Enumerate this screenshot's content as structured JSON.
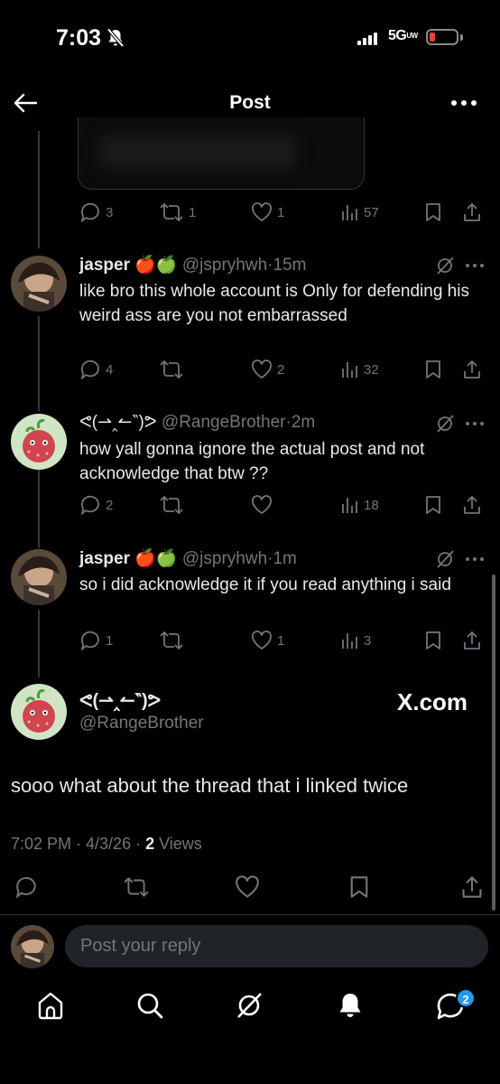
{
  "status_bar": {
    "time": "7:03",
    "network": "5G",
    "network_sub": "UW"
  },
  "header": {
    "title": "Post"
  },
  "parent_post": {
    "stats": {
      "replies": "3",
      "reposts": "1",
      "likes": "1",
      "views": "57"
    }
  },
  "replies": [
    {
      "name": "jasper",
      "emojis": "🍎🍏",
      "handle": "@jspryhwh",
      "time": "15m",
      "text": "like bro this whole account is Only for defending his weird ass are you not embarrassed",
      "stats": {
        "replies": "4",
        "reposts": "",
        "likes": "2",
        "views": "32"
      }
    },
    {
      "name": "ᕙ(⇀‸↼‶)ᕗ",
      "handle": "@RangeBrother",
      "time": "2m",
      "text": "how yall gonna ignore the actual post and not acknowledge that btw ??",
      "stats": {
        "replies": "2",
        "reposts": "",
        "likes": "",
        "views": "18"
      }
    },
    {
      "name": "jasper",
      "emojis": "🍎🍏",
      "handle": "@jspryhwh",
      "time": "1m",
      "text": "so i did acknowledge it if you read anything i said",
      "stats": {
        "replies": "1",
        "reposts": "",
        "likes": "1",
        "views": "3"
      }
    }
  ],
  "main_post": {
    "name": "ᕙ(⇀‸↼‶)ᕗ",
    "handle": "@RangeBrother",
    "watermark": "X.com",
    "text": "sooo what about the thread that i linked twice",
    "timestamp": "7:02 PM · 4/3/26 · ",
    "views_count": "2",
    "views_label": " Views"
  },
  "reply_bar": {
    "placeholder": "Post your reply"
  },
  "tab_bar": {
    "items": [
      "home-icon",
      "search-icon",
      "grok-icon",
      "notifications-icon",
      "messages-icon"
    ],
    "messages_badge": "2"
  },
  "colors": {
    "background": "#000000",
    "text": "#e7e9ea",
    "muted": "#71767b",
    "accent": "#1d9bf0",
    "divider": "#2f3336"
  }
}
